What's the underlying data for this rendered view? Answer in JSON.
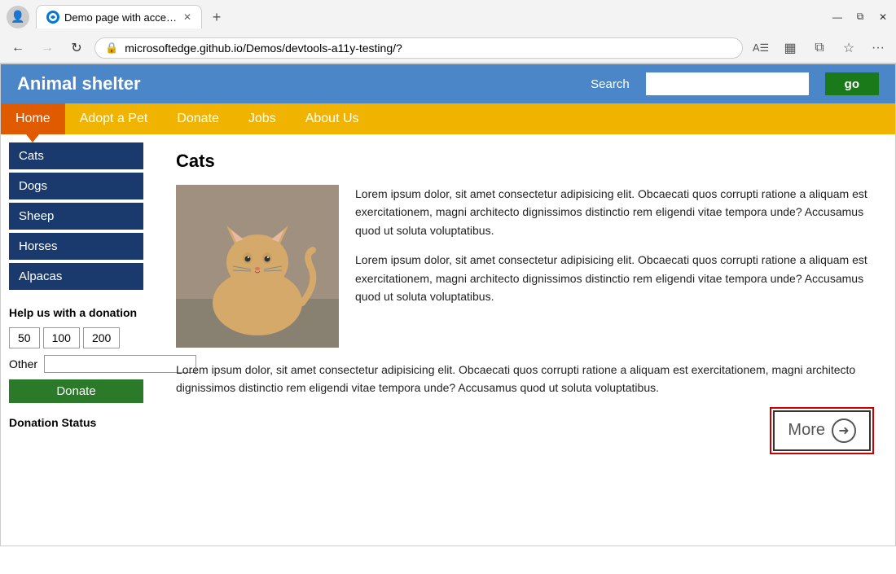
{
  "browser": {
    "tab_title": "Demo page with accessibility issu",
    "favicon_label": "edge-favicon",
    "close_label": "✕",
    "new_tab_label": "+",
    "back_label": "←",
    "forward_label": "→",
    "refresh_label": "↻",
    "search_label": "🔍",
    "url": "microsoftedge.github.io/Demos/devtools-a11y-testing/?",
    "read_aloud_label": "A☰",
    "immersive_reader_label": "▦",
    "picture_in_picture_label": "⧉",
    "favorites_label": "☆",
    "more_tools_label": "···",
    "profile_label": "👤",
    "minimize_label": "—",
    "restore_label": "⧉",
    "close_window_label": "✕"
  },
  "website": {
    "title": "Animal shelter",
    "search_placeholder": "",
    "search_label": "Search",
    "go_button_label": "go",
    "nav": {
      "items": [
        {
          "label": "Home",
          "active": true
        },
        {
          "label": "Adopt a Pet",
          "active": false
        },
        {
          "label": "Donate",
          "active": false
        },
        {
          "label": "Jobs",
          "active": false
        },
        {
          "label": "About Us",
          "active": false
        }
      ]
    },
    "sidebar": {
      "animals": [
        {
          "label": "Cats",
          "active": true
        },
        {
          "label": "Dogs"
        },
        {
          "label": "Sheep"
        },
        {
          "label": "Horses"
        },
        {
          "label": "Alpacas"
        }
      ],
      "donation_section_title": "Help us with a donation",
      "amounts": [
        "50",
        "100",
        "200"
      ],
      "other_label": "Other",
      "donate_button_label": "Donate",
      "donation_status_label": "Donation Status"
    },
    "main": {
      "page_title": "Cats",
      "paragraphs": [
        "Lorem ipsum dolor, sit amet consectetur adipisicing elit. Obcaecati quos corrupti ratione a aliquam est exercitationem, magni architecto dignissimos distinctio rem eligendi vitae tempora unde? Accusamus quod ut soluta voluptatibus.",
        "Lorem ipsum dolor, sit amet consectetur adipisicing elit. Obcaecati quos corrupti ratione a aliquam est exercitationem, magni architecto dignissimos distinctio rem eligendi vitae tempora unde? Accusamus quod ut soluta voluptatibus.",
        "Lorem ipsum dolor, sit amet consectetur adipisicing elit. Obcaecati quos corrupti ratione a aliquam est exercitationem, magni architecto dignissimos distinctio rem eligendi vitae tempora unde? Accusamus quod ut soluta voluptatibus."
      ],
      "more_button_label": "More"
    }
  }
}
